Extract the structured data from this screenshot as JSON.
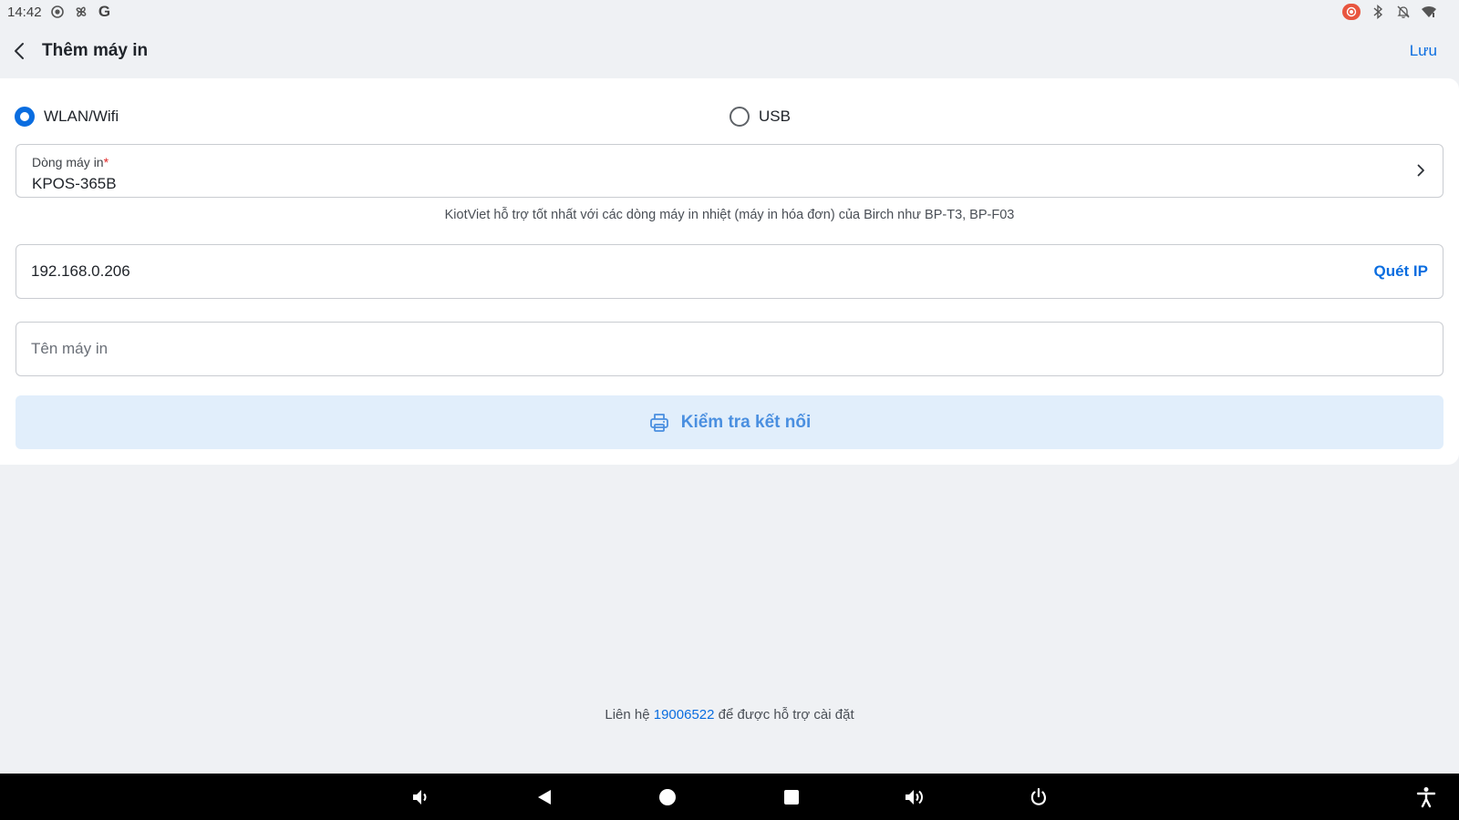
{
  "status_bar": {
    "time": "14:42",
    "left_icons": [
      "screen-record-icon",
      "pinwheel-icon",
      "google-icon"
    ],
    "google_letter": "G",
    "right_icons": [
      "record-indicator-icon",
      "bluetooth-icon",
      "notifications-off-icon",
      "wifi-icon"
    ]
  },
  "header": {
    "title": "Thêm máy in",
    "save_label": "Lưu"
  },
  "connection": {
    "options": [
      {
        "label": "WLAN/Wifi",
        "selected": true
      },
      {
        "label": "USB",
        "selected": false
      }
    ]
  },
  "printer_model": {
    "label": "Dòng máy in",
    "required_mark": "*",
    "value": "KPOS-365B"
  },
  "hint": "KiotViet hỗ trợ tốt nhất với các dòng máy in nhiệt (máy in hóa đơn) của Birch như BP-T3, BP-F03",
  "ip_field": {
    "value": "192.168.0.206",
    "scan_label": "Quét IP"
  },
  "name_field": {
    "value": "",
    "placeholder": "Tên máy in"
  },
  "test_button": {
    "label": "Kiểm tra kết nối",
    "icon": "printer-icon"
  },
  "footer": {
    "prefix": "Liên hệ",
    "phone": "19006522",
    "suffix": "để được hỗ trợ cài đặt"
  },
  "nav_bar": {
    "buttons": [
      "volume-down-icon",
      "back-triangle-icon",
      "home-circle-icon",
      "recents-square-icon",
      "volume-up-icon",
      "power-icon",
      "accessibility-icon"
    ]
  },
  "colors": {
    "accent": "#0a6de0",
    "background": "#eff1f4",
    "button_bg": "#e1eefb",
    "required": "#e02424"
  }
}
